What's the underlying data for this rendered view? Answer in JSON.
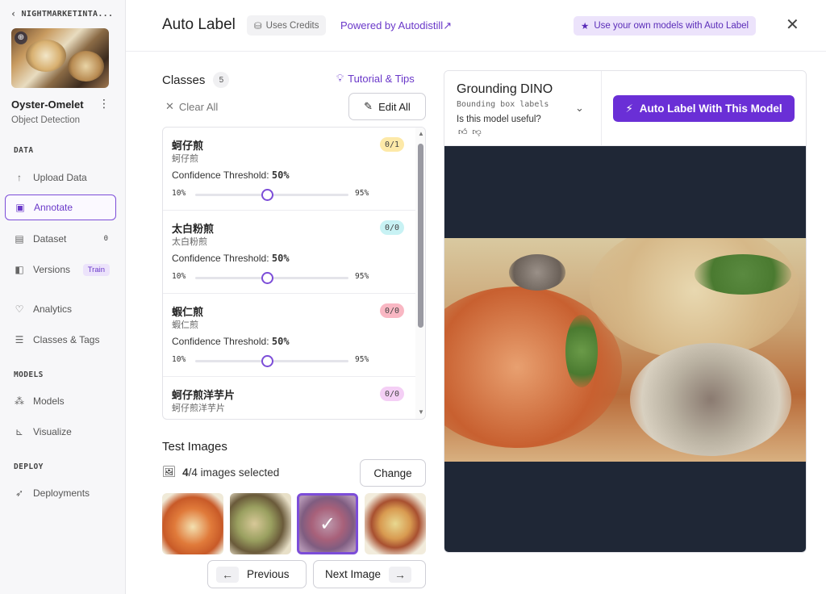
{
  "sidebar": {
    "workspace": "NIGHTMARKETINTA...",
    "project_name": "Oyster-Omelet",
    "project_type": "Object Detection",
    "sections": {
      "data": "DATA",
      "models": "MODELS",
      "deploy": "DEPLOY"
    },
    "items": [
      {
        "label": "Upload Data",
        "icon": "upload-icon"
      },
      {
        "label": "Annotate",
        "icon": "annotate-icon"
      },
      {
        "label": "Dataset",
        "badge": "0",
        "icon": "dataset-icon"
      },
      {
        "label": "Versions",
        "badge": "Train",
        "icon": "versions-icon"
      },
      {
        "label": "Analytics",
        "icon": "analytics-icon"
      },
      {
        "label": "Classes & Tags",
        "icon": "classes-icon"
      },
      {
        "label": "Models",
        "icon": "models-icon"
      },
      {
        "label": "Visualize",
        "icon": "visualize-icon"
      },
      {
        "label": "Deployments",
        "icon": "rocket-icon"
      }
    ]
  },
  "header": {
    "title": "Auto Label",
    "credits": "Uses Credits",
    "powered": "Powered by Autodistill",
    "own_models": "Use your own models with Auto Label"
  },
  "classes": {
    "title": "Classes",
    "count": "5",
    "tips": "Tutorial & Tips",
    "clear_all": "Clear All",
    "edit_all": "Edit All",
    "items": [
      {
        "name": "蚵仔煎",
        "sub": "蚵仔煎",
        "pill": "0/1",
        "pill_color": "#fde9a8",
        "ct_label": "Confidence Threshold:",
        "ct_value": "50%",
        "lo": "10%",
        "hi": "95%",
        "value": 50
      },
      {
        "name": "太白粉煎",
        "sub": "太白粉煎",
        "pill": "0/0",
        "pill_color": "#c8f2f4",
        "ct_label": "Confidence Threshold:",
        "ct_value": "50%",
        "lo": "10%",
        "hi": "95%",
        "value": 50
      },
      {
        "name": "蝦仁煎",
        "sub": "蝦仁煎",
        "pill": "0/0",
        "pill_color": "#f9b7c3",
        "ct_label": "Confidence Threshold:",
        "ct_value": "50%",
        "lo": "10%",
        "hi": "95%",
        "value": 50
      },
      {
        "name": "蚵仔煎洋芋片",
        "sub": "蚵仔煎洋芋片",
        "pill": "0/0",
        "pill_color": "#f4cff5"
      }
    ]
  },
  "test_images": {
    "title": "Test Images",
    "selected_bold": "4",
    "selected_rest": "/4 images selected",
    "change": "Change",
    "previous": "Previous",
    "next": "Next Image"
  },
  "model": {
    "name": "Grounding DINO",
    "subtitle": "Bounding box labels",
    "useful": "Is this model useful?",
    "button": "Auto Label With This Model"
  },
  "colors": {
    "accent": "#6a2fd6",
    "accent_light": "#ece3fb",
    "dark_canvas": "#1f2736"
  }
}
